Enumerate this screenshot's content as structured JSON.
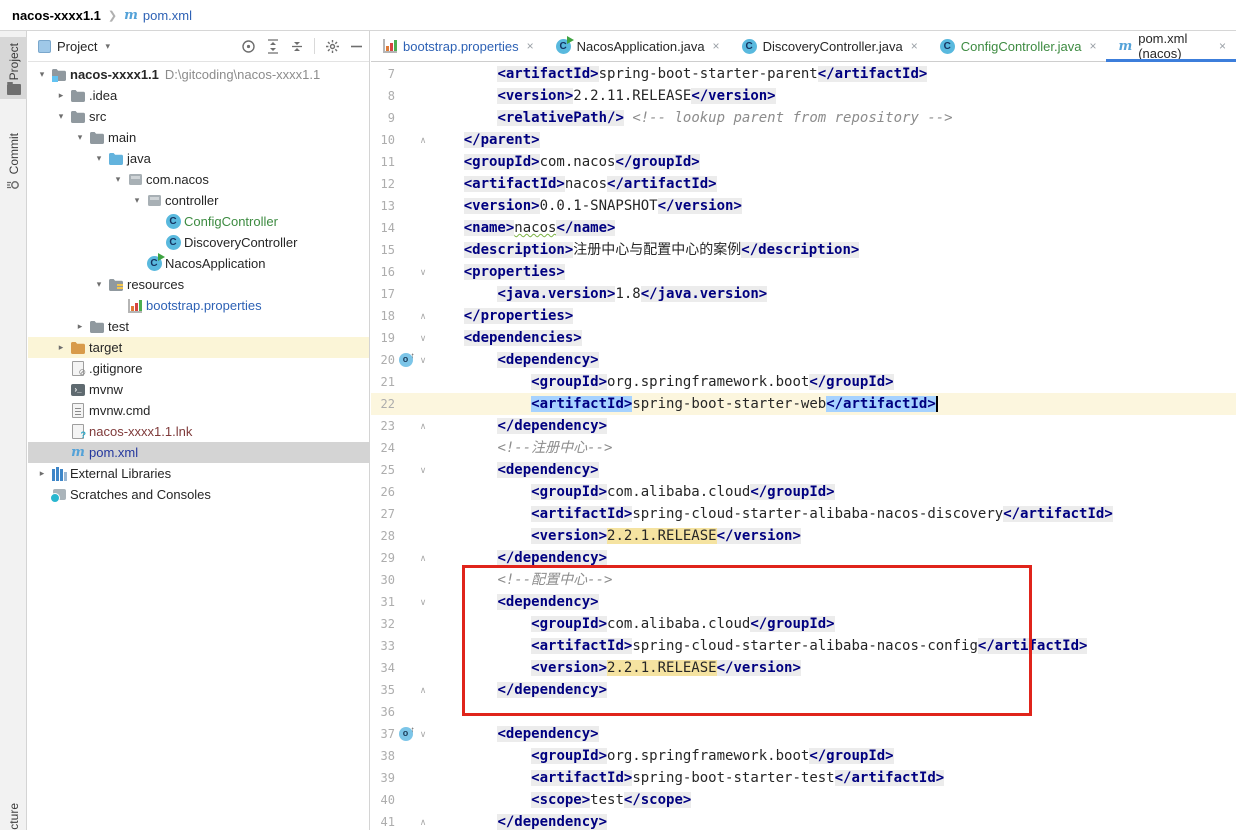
{
  "navbar": {
    "project": "nacos-xxxx1.1",
    "separator": "❯",
    "maven_icon": "m",
    "file": "pom.xml"
  },
  "left_strip": {
    "project_tab": "Project",
    "commit_tab": "Commit",
    "structure_tab": "cture"
  },
  "project_panel": {
    "title": "Project",
    "caret": "▾",
    "tree": [
      {
        "label": "nacos-xxxx1.1",
        "path": "D:\\gitcoding\\nacos-xxxx1.1",
        "icon": "folder-project",
        "chevron": "down",
        "level": 0,
        "bold": true
      },
      {
        "label": ".idea",
        "icon": "folder",
        "chevron": "right",
        "level": 1
      },
      {
        "label": "src",
        "icon": "folder",
        "chevron": "down",
        "level": 1
      },
      {
        "label": "main",
        "icon": "folder",
        "chevron": "down",
        "level": 2
      },
      {
        "label": "java",
        "icon": "folder-src",
        "chevron": "down",
        "level": 3
      },
      {
        "label": "com.nacos",
        "icon": "package",
        "chevron": "down",
        "level": 4
      },
      {
        "label": "controller",
        "icon": "package",
        "chevron": "down",
        "level": 5
      },
      {
        "label": "ConfigController",
        "icon": "class",
        "level": 6,
        "file": true,
        "color": "green"
      },
      {
        "label": "DiscoveryController",
        "icon": "class",
        "level": 6,
        "file": true
      },
      {
        "label": "NacosApplication",
        "icon": "class-run",
        "level": 5,
        "file": true
      },
      {
        "label": "resources",
        "icon": "folder-res",
        "chevron": "down",
        "level": 3
      },
      {
        "label": "bootstrap.properties",
        "icon": "properties",
        "level": 4,
        "file": true,
        "color": "blue"
      },
      {
        "label": "test",
        "icon": "folder",
        "chevron": "right",
        "level": 2
      },
      {
        "label": "target",
        "icon": "folder-target",
        "chevron": "right",
        "level": 1,
        "rowbg": "yellow"
      },
      {
        "label": ".gitignore",
        "icon": "gitignore",
        "level": 1,
        "file": true
      },
      {
        "label": "mvnw",
        "icon": "console",
        "level": 1,
        "file": true
      },
      {
        "label": "mvnw.cmd",
        "icon": "textfile",
        "level": 1,
        "file": true
      },
      {
        "label": "nacos-xxxx1.1.lnk",
        "icon": "unknown",
        "level": 1,
        "file": true,
        "color": "darkred"
      },
      {
        "label": "pom.xml",
        "icon": "maven",
        "level": 1,
        "file": true,
        "selected": true,
        "color": "navy"
      },
      {
        "label": "External Libraries",
        "icon": "libraries",
        "chevron": "right",
        "level": 0
      },
      {
        "label": "Scratches and Consoles",
        "icon": "scratches",
        "level": 0,
        "file": true
      }
    ]
  },
  "editor": {
    "tabs": [
      {
        "label": "bootstrap.properties",
        "icon": "properties",
        "color": "blue",
        "close": "×"
      },
      {
        "label": "NacosApplication.java",
        "icon": "class-run",
        "close": "×"
      },
      {
        "label": "DiscoveryController.java",
        "icon": "class",
        "close": "×"
      },
      {
        "label": "ConfigController.java",
        "icon": "class",
        "color": "green",
        "close": "×"
      },
      {
        "label": "pom.xml (nacos)",
        "icon": "maven",
        "active": true,
        "close": "×"
      }
    ],
    "lines": [
      {
        "num": 7,
        "tokens": [
          {
            "t": "p",
            "s": "        "
          },
          {
            "t": "t",
            "s": "<artifactId>"
          },
          {
            "t": "p",
            "s": "spring-boot-starter-parent"
          },
          {
            "t": "t",
            "s": "</artifactId>"
          }
        ]
      },
      {
        "num": 8,
        "tokens": [
          {
            "t": "p",
            "s": "        "
          },
          {
            "t": "t",
            "s": "<version>"
          },
          {
            "t": "p",
            "s": "2.2.11.RELEASE"
          },
          {
            "t": "t",
            "s": "</version>"
          }
        ]
      },
      {
        "num": 9,
        "tokens": [
          {
            "t": "p",
            "s": "        "
          },
          {
            "t": "t",
            "s": "<relativePath/>"
          },
          {
            "t": "p",
            "s": " "
          },
          {
            "t": "c",
            "s": "<!-- lookup parent from repository -->"
          }
        ]
      },
      {
        "num": 10,
        "fold": "up",
        "tokens": [
          {
            "t": "p",
            "s": "    "
          },
          {
            "t": "t",
            "s": "</parent>"
          }
        ]
      },
      {
        "num": 11,
        "tokens": [
          {
            "t": "p",
            "s": "    "
          },
          {
            "t": "t",
            "s": "<groupId>"
          },
          {
            "t": "p",
            "s": "com.nacos"
          },
          {
            "t": "t",
            "s": "</groupId>"
          }
        ]
      },
      {
        "num": 12,
        "tokens": [
          {
            "t": "p",
            "s": "    "
          },
          {
            "t": "t",
            "s": "<artifactId>"
          },
          {
            "t": "p",
            "s": "nacos"
          },
          {
            "t": "t",
            "s": "</artifactId>"
          }
        ]
      },
      {
        "num": 13,
        "tokens": [
          {
            "t": "p",
            "s": "    "
          },
          {
            "t": "t",
            "s": "<version>"
          },
          {
            "t": "p",
            "s": "0.0.1-SNAPSHOT"
          },
          {
            "t": "t",
            "s": "</version>"
          }
        ]
      },
      {
        "num": 14,
        "tokens": [
          {
            "t": "p",
            "s": "    "
          },
          {
            "t": "t",
            "s": "<name>"
          },
          {
            "t": "w",
            "s": "nacos"
          },
          {
            "t": "t",
            "s": "</name>"
          }
        ]
      },
      {
        "num": 15,
        "tokens": [
          {
            "t": "p",
            "s": "    "
          },
          {
            "t": "t",
            "s": "<description>"
          },
          {
            "t": "p",
            "s": "注册中心与配置中心的案例"
          },
          {
            "t": "t",
            "s": "</description>"
          }
        ]
      },
      {
        "num": 16,
        "fold": "down",
        "tokens": [
          {
            "t": "p",
            "s": "    "
          },
          {
            "t": "t",
            "s": "<properties>"
          }
        ]
      },
      {
        "num": 17,
        "tokens": [
          {
            "t": "p",
            "s": "        "
          },
          {
            "t": "t",
            "s": "<java.version>"
          },
          {
            "t": "p",
            "s": "1.8"
          },
          {
            "t": "t",
            "s": "</java.version>"
          }
        ]
      },
      {
        "num": 18,
        "fold": "up",
        "tokens": [
          {
            "t": "p",
            "s": "    "
          },
          {
            "t": "t",
            "s": "</properties>"
          }
        ]
      },
      {
        "num": 19,
        "fold": "down",
        "tokens": [
          {
            "t": "p",
            "s": "    "
          },
          {
            "t": "t",
            "s": "<dependencies>"
          }
        ]
      },
      {
        "num": 20,
        "fold": "down",
        "gicon": "maven",
        "tokens": [
          {
            "t": "p",
            "s": "        "
          },
          {
            "t": "t",
            "s": "<dependency>"
          }
        ]
      },
      {
        "num": 21,
        "tokens": [
          {
            "t": "p",
            "s": "            "
          },
          {
            "t": "t",
            "s": "<groupId>"
          },
          {
            "t": "p",
            "s": "org.springframework.boot"
          },
          {
            "t": "t",
            "s": "</groupId>"
          }
        ]
      },
      {
        "num": 22,
        "current": true,
        "tokens": [
          {
            "t": "p",
            "s": "            "
          },
          {
            "t": "th",
            "s": "<artifactId>"
          },
          {
            "t": "p",
            "s": "spring-boot-starter-web"
          },
          {
            "t": "th",
            "s": "</artifactId>"
          },
          {
            "t": "caret",
            "s": ""
          }
        ]
      },
      {
        "num": 23,
        "fold": "up",
        "tokens": [
          {
            "t": "p",
            "s": "        "
          },
          {
            "t": "t",
            "s": "</dependency>"
          }
        ]
      },
      {
        "num": 24,
        "tokens": [
          {
            "t": "p",
            "s": "        "
          },
          {
            "t": "c",
            "s": "<!--注册中心-->"
          }
        ]
      },
      {
        "num": 25,
        "fold": "down",
        "tokens": [
          {
            "t": "p",
            "s": "        "
          },
          {
            "t": "t",
            "s": "<dependency>"
          }
        ]
      },
      {
        "num": 26,
        "tokens": [
          {
            "t": "p",
            "s": "            "
          },
          {
            "t": "t",
            "s": "<groupId>"
          },
          {
            "t": "p",
            "s": "com.alibaba.cloud"
          },
          {
            "t": "t",
            "s": "</groupId>"
          }
        ]
      },
      {
        "num": 27,
        "tokens": [
          {
            "t": "p",
            "s": "            "
          },
          {
            "t": "t",
            "s": "<artifactId>"
          },
          {
            "t": "p",
            "s": "spring-cloud-starter-alibaba-nacos-discovery"
          },
          {
            "t": "t",
            "s": "</artifactId>"
          }
        ]
      },
      {
        "num": 28,
        "tokens": [
          {
            "t": "p",
            "s": "            "
          },
          {
            "t": "t",
            "s": "<version>"
          },
          {
            "t": "y",
            "s": "2.2.1.RELEASE"
          },
          {
            "t": "t",
            "s": "</version>"
          }
        ]
      },
      {
        "num": 29,
        "fold": "up",
        "tokens": [
          {
            "t": "p",
            "s": "        "
          },
          {
            "t": "t",
            "s": "</dependency>"
          }
        ]
      },
      {
        "num": 30,
        "changed": true,
        "tokens": [
          {
            "t": "p",
            "s": "        "
          },
          {
            "t": "c",
            "s": "<!--配置中心-->"
          }
        ]
      },
      {
        "num": 31,
        "changed": true,
        "fold": "down",
        "tokens": [
          {
            "t": "p",
            "s": "        "
          },
          {
            "t": "t",
            "s": "<dependency>"
          }
        ]
      },
      {
        "num": 32,
        "changed": true,
        "tokens": [
          {
            "t": "p",
            "s": "            "
          },
          {
            "t": "t",
            "s": "<groupId>"
          },
          {
            "t": "p",
            "s": "com.alibaba.cloud"
          },
          {
            "t": "t",
            "s": "</groupId>"
          }
        ]
      },
      {
        "num": 33,
        "changed": true,
        "tokens": [
          {
            "t": "p",
            "s": "            "
          },
          {
            "t": "t",
            "s": "<artifactId>"
          },
          {
            "t": "p",
            "s": "spring-cloud-starter-alibaba-nacos-config"
          },
          {
            "t": "t",
            "s": "</artifactId>"
          }
        ]
      },
      {
        "num": 34,
        "changed": true,
        "tokens": [
          {
            "t": "p",
            "s": "            "
          },
          {
            "t": "t",
            "s": "<version>"
          },
          {
            "t": "y",
            "s": "2.2.1.RELEASE"
          },
          {
            "t": "t",
            "s": "</version>"
          }
        ]
      },
      {
        "num": 35,
        "changed": true,
        "fold": "up",
        "tokens": [
          {
            "t": "p",
            "s": "        "
          },
          {
            "t": "t",
            "s": "</dependency>"
          }
        ]
      },
      {
        "num": 36,
        "tokens": []
      },
      {
        "num": 37,
        "fold": "down",
        "gicon": "maven",
        "tokens": [
          {
            "t": "p",
            "s": "        "
          },
          {
            "t": "t",
            "s": "<dependency>"
          }
        ]
      },
      {
        "num": 38,
        "tokens": [
          {
            "t": "p",
            "s": "            "
          },
          {
            "t": "t",
            "s": "<groupId>"
          },
          {
            "t": "p",
            "s": "org.springframework.boot"
          },
          {
            "t": "t",
            "s": "</groupId>"
          }
        ]
      },
      {
        "num": 39,
        "tokens": [
          {
            "t": "p",
            "s": "            "
          },
          {
            "t": "t",
            "s": "<artifactId>"
          },
          {
            "t": "p",
            "s": "spring-boot-starter-test"
          },
          {
            "t": "t",
            "s": "</artifactId>"
          }
        ]
      },
      {
        "num": 40,
        "tokens": [
          {
            "t": "p",
            "s": "            "
          },
          {
            "t": "t",
            "s": "<scope>"
          },
          {
            "t": "p",
            "s": "test"
          },
          {
            "t": "t",
            "s": "</scope>"
          }
        ]
      },
      {
        "num": 41,
        "fold": "up",
        "tokens": [
          {
            "t": "p",
            "s": "        "
          },
          {
            "t": "t",
            "s": "</dependency>"
          }
        ]
      }
    ]
  },
  "annotation": {
    "color": "#e0241b"
  },
  "colors": {
    "tag": "#000080",
    "tag_bg": "#ececec",
    "matched_tag_bg": "#a6d2ff",
    "caret_row": "#fcf6de",
    "value_highlight": "#f5e3a1",
    "comment": "#8c8c8c",
    "vcs_added_bar": "#acd2a0",
    "active_tab_underline": "#3c7edb",
    "modified_file": "#2e62b5",
    "added_file": "#3d8b41",
    "unversioned_file": "#7f3a3a"
  }
}
